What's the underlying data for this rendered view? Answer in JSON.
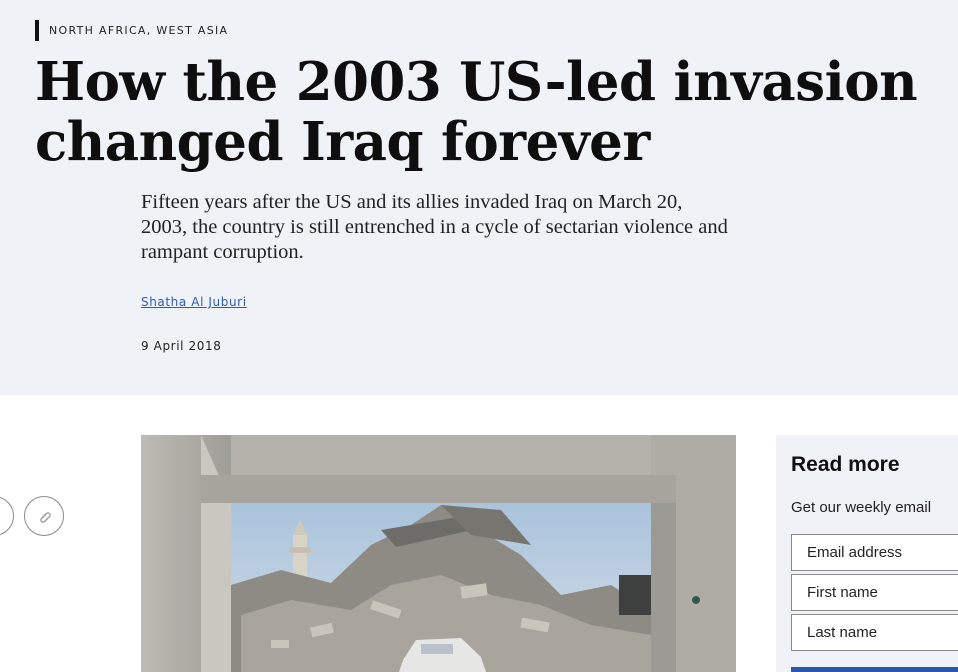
{
  "article": {
    "section_tag": "NORTH AFRICA, WEST ASIA",
    "title": "How the 2003 US-led invasion changed Iraq forever",
    "standfirst": "Fifteen years after the US and its allies invaded Iraq on March 20, 2003, the country is still entrenched in a cycle of sectarian violence and rampant corruption.",
    "author": "Shatha Al Juburi",
    "date": "9 April 2018"
  },
  "share": {
    "icons": [
      "share-icon",
      "link-icon"
    ]
  },
  "hero_image": {
    "description_icon": "photo-destroyed-building"
  },
  "sidebar": {
    "title": "Read more",
    "subtitle": "Get our weekly email",
    "email_placeholder": "Email address",
    "first_name_placeholder": "First name",
    "last_name_placeholder": "Last name"
  },
  "colors": {
    "hero_bg": "#eff2f7",
    "link": "#2b5cb8",
    "button": "#2b57a8"
  }
}
